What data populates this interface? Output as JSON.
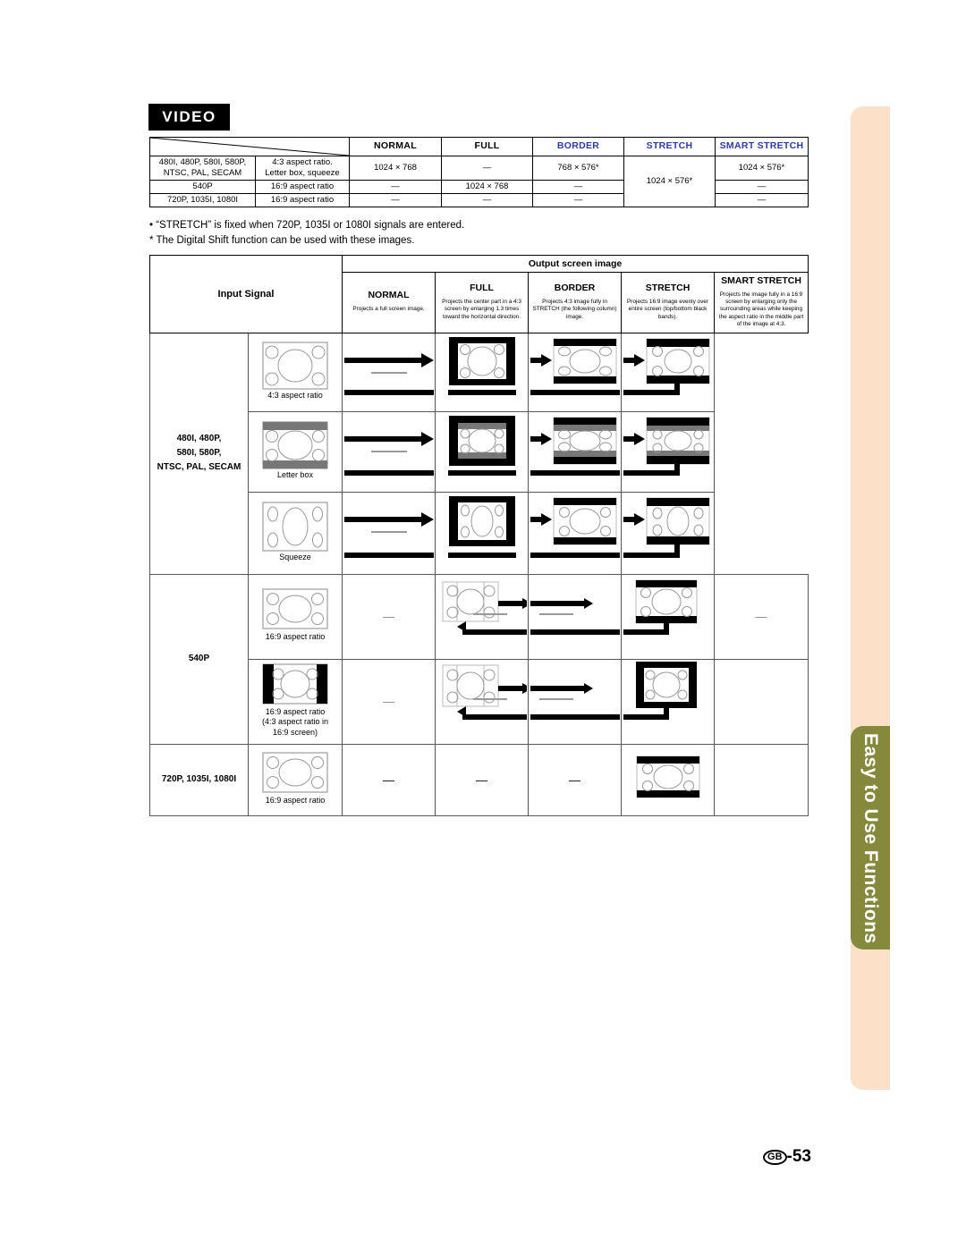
{
  "page": {
    "section_badge": "VIDEO",
    "side_tab_label": "Easy to Use Functions",
    "footer_region": "GB",
    "footer_page": "-53"
  },
  "table1": {
    "headers": [
      "",
      "",
      "NORMAL",
      "FULL",
      "BORDER",
      "STRETCH",
      "SMART STRETCH"
    ],
    "header_colors": {
      "normal": "#000000",
      "full": "#000000",
      "border": "#2a3ba8",
      "stretch": "#2a3ba8",
      "smart_stretch": "#2a3ba8"
    },
    "rows": [
      {
        "signal": "480I, 480P, 580I, 580P,\nNTSC, PAL, SECAM",
        "signal_l1": "480I, 480P, 580I, 580P,",
        "signal_l2": "NTSC, PAL, SECAM",
        "aspect_l1": "4:3 aspect ratio.",
        "aspect_l2": "Letter box, squeeze",
        "normal": "1024 × 768",
        "full": "—",
        "border": "768 × 576*",
        "stretch": "1024 × 576*",
        "smart_stretch": "1024 × 576*"
      },
      {
        "signal_l1": "540P",
        "signal_l2": "",
        "aspect_l1": "16:9 aspect ratio",
        "aspect_l2": "",
        "normal": "—",
        "full": "1024 × 768",
        "border": "—",
        "smart_stretch": "—"
      },
      {
        "signal_l1": "720P, 1035I, 1080I",
        "signal_l2": "",
        "aspect_l1": "16:9 aspect ratio",
        "aspect_l2": "",
        "normal": "—",
        "full": "—",
        "border": "—",
        "smart_stretch": "—"
      }
    ]
  },
  "notes": {
    "note1": "• “STRETCH” is fixed when 720P, 1035I or 1080I signals are entered.",
    "note2": "* The Digital Shift function can be used with these images."
  },
  "table2": {
    "input_signal_label": "Input Signal",
    "output_group_label": "Output screen image",
    "modes": [
      {
        "name": "NORMAL",
        "desc": "Projects a full screen image."
      },
      {
        "name": "FULL",
        "desc": "Projects the center part in a 4:3 screen by enlarging 1.3 times toward the horizontal direction."
      },
      {
        "name": "BORDER",
        "desc": "Projects 4:3 image fully in STRETCH (the following column) image."
      },
      {
        "name": "STRETCH",
        "desc": "Projects 16:9 image evenly over entire screen (top/bottom black bands)."
      },
      {
        "name": "SMART STRETCH",
        "desc": "Projects the image fully in a 16:9 screen by enlarging only the surrounding areas while keeping the aspect ratio in the middle part of the image at 4:3."
      }
    ],
    "signal_groups": [
      {
        "label_l1": "480I, 480P,",
        "label_l2": "580I, 580P,",
        "label_l3": "NTSC, PAL, SECAM",
        "rows": 3
      },
      {
        "label_l1": "540P",
        "label_l2": "",
        "label_l3": "",
        "rows": 2
      },
      {
        "label_l1": "720P, 1035I, 1080I",
        "label_l2": "",
        "label_l3": "",
        "rows": 1
      }
    ],
    "input_captions": [
      {
        "line1": "4:3 aspect ratio",
        "line2": "",
        "line3": ""
      },
      {
        "line1": "Letter box",
        "line2": "",
        "line3": ""
      },
      {
        "line1": "Squeeze",
        "line2": "",
        "line3": ""
      },
      {
        "line1": "16:9 aspect ratio",
        "line2": "",
        "line3": ""
      },
      {
        "line1": "16:9 aspect ratio",
        "line2": "(4:3 aspect ratio in",
        "line3": "16:9 screen)"
      },
      {
        "line1": "16:9 aspect ratio",
        "line2": "",
        "line3": ""
      }
    ],
    "dash": "—"
  }
}
